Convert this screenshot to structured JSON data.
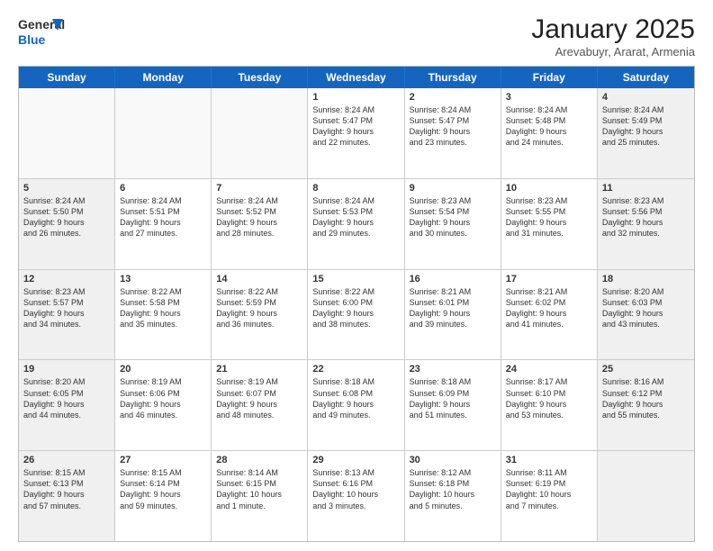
{
  "header": {
    "logo_line1": "General",
    "logo_line2": "Blue",
    "month_title": "January 2025",
    "subtitle": "Arevabuyr, Ararat, Armenia"
  },
  "weekdays": [
    "Sunday",
    "Monday",
    "Tuesday",
    "Wednesday",
    "Thursday",
    "Friday",
    "Saturday"
  ],
  "rows": [
    [
      {
        "day": "",
        "text": "",
        "shaded": false,
        "empty": true
      },
      {
        "day": "",
        "text": "",
        "shaded": false,
        "empty": true
      },
      {
        "day": "",
        "text": "",
        "shaded": false,
        "empty": true
      },
      {
        "day": "1",
        "text": "Sunrise: 8:24 AM\nSunset: 5:47 PM\nDaylight: 9 hours\nand 22 minutes.",
        "shaded": false,
        "empty": false
      },
      {
        "day": "2",
        "text": "Sunrise: 8:24 AM\nSunset: 5:47 PM\nDaylight: 9 hours\nand 23 minutes.",
        "shaded": false,
        "empty": false
      },
      {
        "day": "3",
        "text": "Sunrise: 8:24 AM\nSunset: 5:48 PM\nDaylight: 9 hours\nand 24 minutes.",
        "shaded": false,
        "empty": false
      },
      {
        "day": "4",
        "text": "Sunrise: 8:24 AM\nSunset: 5:49 PM\nDaylight: 9 hours\nand 25 minutes.",
        "shaded": true,
        "empty": false
      }
    ],
    [
      {
        "day": "5",
        "text": "Sunrise: 8:24 AM\nSunset: 5:50 PM\nDaylight: 9 hours\nand 26 minutes.",
        "shaded": true,
        "empty": false
      },
      {
        "day": "6",
        "text": "Sunrise: 8:24 AM\nSunset: 5:51 PM\nDaylight: 9 hours\nand 27 minutes.",
        "shaded": false,
        "empty": false
      },
      {
        "day": "7",
        "text": "Sunrise: 8:24 AM\nSunset: 5:52 PM\nDaylight: 9 hours\nand 28 minutes.",
        "shaded": false,
        "empty": false
      },
      {
        "day": "8",
        "text": "Sunrise: 8:24 AM\nSunset: 5:53 PM\nDaylight: 9 hours\nand 29 minutes.",
        "shaded": false,
        "empty": false
      },
      {
        "day": "9",
        "text": "Sunrise: 8:23 AM\nSunset: 5:54 PM\nDaylight: 9 hours\nand 30 minutes.",
        "shaded": false,
        "empty": false
      },
      {
        "day": "10",
        "text": "Sunrise: 8:23 AM\nSunset: 5:55 PM\nDaylight: 9 hours\nand 31 minutes.",
        "shaded": false,
        "empty": false
      },
      {
        "day": "11",
        "text": "Sunrise: 8:23 AM\nSunset: 5:56 PM\nDaylight: 9 hours\nand 32 minutes.",
        "shaded": true,
        "empty": false
      }
    ],
    [
      {
        "day": "12",
        "text": "Sunrise: 8:23 AM\nSunset: 5:57 PM\nDaylight: 9 hours\nand 34 minutes.",
        "shaded": true,
        "empty": false
      },
      {
        "day": "13",
        "text": "Sunrise: 8:22 AM\nSunset: 5:58 PM\nDaylight: 9 hours\nand 35 minutes.",
        "shaded": false,
        "empty": false
      },
      {
        "day": "14",
        "text": "Sunrise: 8:22 AM\nSunset: 5:59 PM\nDaylight: 9 hours\nand 36 minutes.",
        "shaded": false,
        "empty": false
      },
      {
        "day": "15",
        "text": "Sunrise: 8:22 AM\nSunset: 6:00 PM\nDaylight: 9 hours\nand 38 minutes.",
        "shaded": false,
        "empty": false
      },
      {
        "day": "16",
        "text": "Sunrise: 8:21 AM\nSunset: 6:01 PM\nDaylight: 9 hours\nand 39 minutes.",
        "shaded": false,
        "empty": false
      },
      {
        "day": "17",
        "text": "Sunrise: 8:21 AM\nSunset: 6:02 PM\nDaylight: 9 hours\nand 41 minutes.",
        "shaded": false,
        "empty": false
      },
      {
        "day": "18",
        "text": "Sunrise: 8:20 AM\nSunset: 6:03 PM\nDaylight: 9 hours\nand 43 minutes.",
        "shaded": true,
        "empty": false
      }
    ],
    [
      {
        "day": "19",
        "text": "Sunrise: 8:20 AM\nSunset: 6:05 PM\nDaylight: 9 hours\nand 44 minutes.",
        "shaded": true,
        "empty": false
      },
      {
        "day": "20",
        "text": "Sunrise: 8:19 AM\nSunset: 6:06 PM\nDaylight: 9 hours\nand 46 minutes.",
        "shaded": false,
        "empty": false
      },
      {
        "day": "21",
        "text": "Sunrise: 8:19 AM\nSunset: 6:07 PM\nDaylight: 9 hours\nand 48 minutes.",
        "shaded": false,
        "empty": false
      },
      {
        "day": "22",
        "text": "Sunrise: 8:18 AM\nSunset: 6:08 PM\nDaylight: 9 hours\nand 49 minutes.",
        "shaded": false,
        "empty": false
      },
      {
        "day": "23",
        "text": "Sunrise: 8:18 AM\nSunset: 6:09 PM\nDaylight: 9 hours\nand 51 minutes.",
        "shaded": false,
        "empty": false
      },
      {
        "day": "24",
        "text": "Sunrise: 8:17 AM\nSunset: 6:10 PM\nDaylight: 9 hours\nand 53 minutes.",
        "shaded": false,
        "empty": false
      },
      {
        "day": "25",
        "text": "Sunrise: 8:16 AM\nSunset: 6:12 PM\nDaylight: 9 hours\nand 55 minutes.",
        "shaded": true,
        "empty": false
      }
    ],
    [
      {
        "day": "26",
        "text": "Sunrise: 8:15 AM\nSunset: 6:13 PM\nDaylight: 9 hours\nand 57 minutes.",
        "shaded": true,
        "empty": false
      },
      {
        "day": "27",
        "text": "Sunrise: 8:15 AM\nSunset: 6:14 PM\nDaylight: 9 hours\nand 59 minutes.",
        "shaded": false,
        "empty": false
      },
      {
        "day": "28",
        "text": "Sunrise: 8:14 AM\nSunset: 6:15 PM\nDaylight: 10 hours\nand 1 minute.",
        "shaded": false,
        "empty": false
      },
      {
        "day": "29",
        "text": "Sunrise: 8:13 AM\nSunset: 6:16 PM\nDaylight: 10 hours\nand 3 minutes.",
        "shaded": false,
        "empty": false
      },
      {
        "day": "30",
        "text": "Sunrise: 8:12 AM\nSunset: 6:18 PM\nDaylight: 10 hours\nand 5 minutes.",
        "shaded": false,
        "empty": false
      },
      {
        "day": "31",
        "text": "Sunrise: 8:11 AM\nSunset: 6:19 PM\nDaylight: 10 hours\nand 7 minutes.",
        "shaded": false,
        "empty": false
      },
      {
        "day": "",
        "text": "",
        "shaded": true,
        "empty": true
      }
    ]
  ]
}
